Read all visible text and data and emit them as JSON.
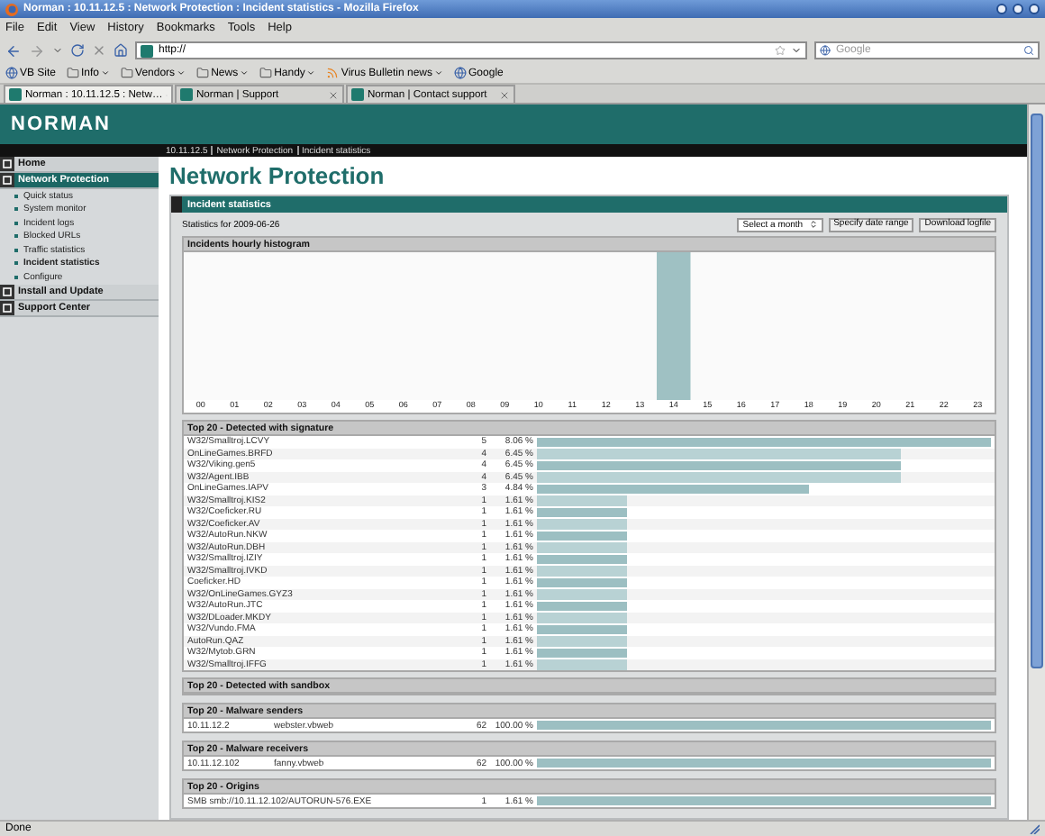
{
  "window": {
    "title": "Norman : 10.11.12.5 : Network Protection : Incident statistics - Mozilla Firefox"
  },
  "menu": [
    "File",
    "Edit",
    "View",
    "History",
    "Bookmarks",
    "Tools",
    "Help"
  ],
  "address": {
    "value": "http://"
  },
  "search": {
    "placeholder": "Google"
  },
  "bookmarks": [
    {
      "label": "VB Site",
      "kind": "site"
    },
    {
      "label": "Info",
      "kind": "folder"
    },
    {
      "label": "Vendors",
      "kind": "folder"
    },
    {
      "label": "News",
      "kind": "folder"
    },
    {
      "label": "Handy",
      "kind": "folder"
    },
    {
      "label": "Virus Bulletin news",
      "kind": "feed"
    },
    {
      "label": "Google",
      "kind": "site"
    }
  ],
  "tabs": [
    {
      "label": "Norman : 10.11.12.5 : Netw…",
      "selected": true
    },
    {
      "label": "Norman | Support",
      "selected": false
    },
    {
      "label": "Norman | Contact support",
      "selected": false
    }
  ],
  "logo": "NORMAN",
  "breadcrumb": [
    "10.11.12.5",
    "Network Protection",
    "Incident statistics"
  ],
  "sidebar": {
    "items": [
      {
        "label": "Home",
        "selected": false
      },
      {
        "label": "Network Protection",
        "selected": true,
        "expanded": true,
        "children": [
          {
            "label": "Quick status",
            "selected": false
          },
          {
            "label": "System monitor",
            "selected": false
          },
          {
            "label": "Incident logs",
            "selected": false
          },
          {
            "label": "Blocked URLs",
            "selected": false
          },
          {
            "label": "Traffic statistics",
            "selected": false
          },
          {
            "label": "Incident statistics",
            "selected": true
          },
          {
            "label": "Configure",
            "selected": false
          }
        ]
      },
      {
        "label": "Install and Update",
        "selected": false
      },
      {
        "label": "Support Center",
        "selected": false
      }
    ]
  },
  "page_title": "Network Protection",
  "panel": {
    "title": "Incident statistics",
    "statistics_for": "Statistics for 2009-06-26",
    "month_select": "Select a month",
    "buttons": [
      "Specify date range",
      "Download logfile"
    ]
  },
  "histogram": {
    "title": "Incidents hourly histogram",
    "hours": [
      "00",
      "01",
      "02",
      "03",
      "04",
      "05",
      "06",
      "07",
      "08",
      "09",
      "10",
      "11",
      "12",
      "13",
      "14",
      "15",
      "16",
      "17",
      "18",
      "19",
      "20",
      "21",
      "22",
      "23"
    ]
  },
  "signature": {
    "title": "Top 20 - Detected with signature",
    "rows": [
      {
        "name": "W32/Smalltroj.LCVY",
        "count": "5",
        "percent": "8.06 %",
        "level": 1
      },
      {
        "name": "OnLineGames.BRFD",
        "count": "4",
        "percent": "6.45 %",
        "level": 0.8
      },
      {
        "name": "W32/Viking.gen5",
        "count": "4",
        "percent": "6.45 %",
        "level": 0.8
      },
      {
        "name": "W32/Agent.IBB",
        "count": "4",
        "percent": "6.45 %",
        "level": 0.8
      },
      {
        "name": "OnLineGames.IAPV",
        "count": "3",
        "percent": "4.84 %",
        "level": 0.6
      },
      {
        "name": "W32/Smalltroj.KIS2",
        "count": "1",
        "percent": "1.61 %",
        "level": 0.2
      },
      {
        "name": "W32/Coeficker.RU",
        "count": "1",
        "percent": "1.61 %",
        "level": 0.2
      },
      {
        "name": "W32/Coeficker.AV",
        "count": "1",
        "percent": "1.61 %",
        "level": 0.2
      },
      {
        "name": "W32/AutoRun.NKW",
        "count": "1",
        "percent": "1.61 %",
        "level": 0.2
      },
      {
        "name": "W32/AutoRun.DBH",
        "count": "1",
        "percent": "1.61 %",
        "level": 0.2
      },
      {
        "name": "W32/Smalltroj.IZIY",
        "count": "1",
        "percent": "1.61 %",
        "level": 0.2
      },
      {
        "name": "W32/Smalltroj.IVKD",
        "count": "1",
        "percent": "1.61 %",
        "level": 0.2
      },
      {
        "name": "Coeficker.HD",
        "count": "1",
        "percent": "1.61 %",
        "level": 0.2
      },
      {
        "name": "W32/OnLineGames.GYZ3",
        "count": "1",
        "percent": "1.61 %",
        "level": 0.2
      },
      {
        "name": "W32/AutoRun.JTC",
        "count": "1",
        "percent": "1.61 %",
        "level": 0.2
      },
      {
        "name": "W32/DLoader.MKDY",
        "count": "1",
        "percent": "1.61 %",
        "level": 0.2
      },
      {
        "name": "W32/Vundo.FMA",
        "count": "1",
        "percent": "1.61 %",
        "level": 0.2
      },
      {
        "name": "AutoRun.QAZ",
        "count": "1",
        "percent": "1.61 %",
        "level": 0.2
      },
      {
        "name": "W32/Mytob.GRN",
        "count": "1",
        "percent": "1.61 %",
        "level": 0.2
      },
      {
        "name": "W32/Smalltroj.IFFG",
        "count": "1",
        "percent": "1.61 %",
        "level": 0.2
      }
    ]
  },
  "sections": [
    {
      "title": "Top 20 - Detected with sandbox"
    },
    {
      "title": "Top 20 - Malware senders",
      "rows": [
        {
          "cells": [
            "10.11.12.2",
            "webster.vbweb"
          ],
          "count": "62",
          "percent": "100.00 %",
          "level": 1
        }
      ]
    },
    {
      "title": "Top 20 - Malware receivers",
      "rows": [
        {
          "cells": [
            "10.11.12.102",
            "fanny.vbweb"
          ],
          "count": "62",
          "percent": "100.00 %",
          "level": 1
        }
      ]
    },
    {
      "title": "Top 20 - Origins",
      "rows": [
        {
          "cells": [
            "SMB smb://10.11.12.102/AUTORUN-576.EXE"
          ],
          "count": "1",
          "percent": "1.61 %",
          "level": 1
        }
      ]
    }
  ],
  "status": "Done"
}
